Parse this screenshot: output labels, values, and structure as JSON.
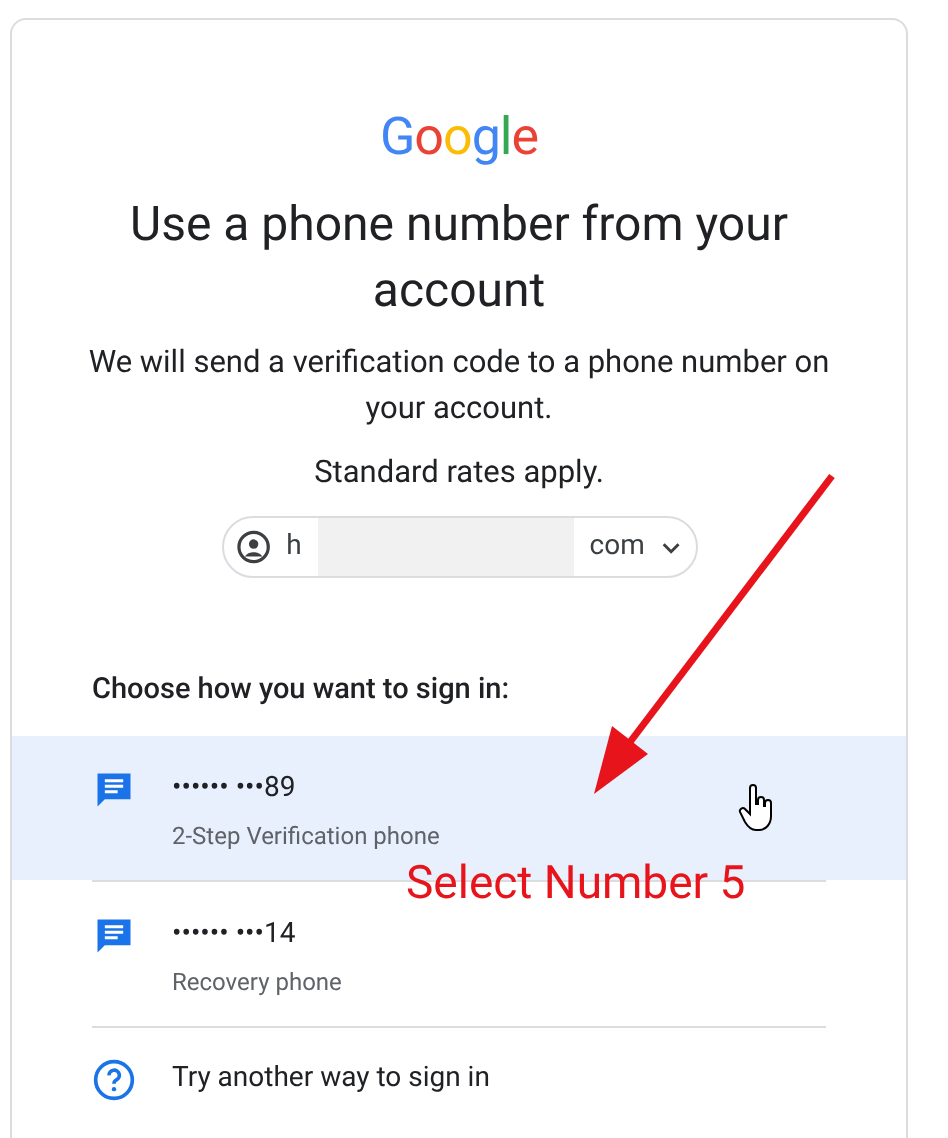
{
  "logo": "Google",
  "heading": "Use a phone number from your account",
  "description": "We will send a verification code to a phone number on your account.",
  "note": "Standard rates apply.",
  "account_chip": {
    "text_start": "h",
    "text_end": "com",
    "redacted": true
  },
  "prompt": "Choose how you want to sign in:",
  "options": [
    {
      "kind": "phone",
      "number": "•••••• •••89",
      "label": "2-Step Verification phone",
      "selected": true
    },
    {
      "kind": "phone",
      "number": "•••••• •••14",
      "label": "Recovery phone",
      "selected": false
    },
    {
      "kind": "other",
      "number": "Try another way to sign in",
      "selected": false
    }
  ],
  "annotation": {
    "text": "Select Number 5"
  }
}
